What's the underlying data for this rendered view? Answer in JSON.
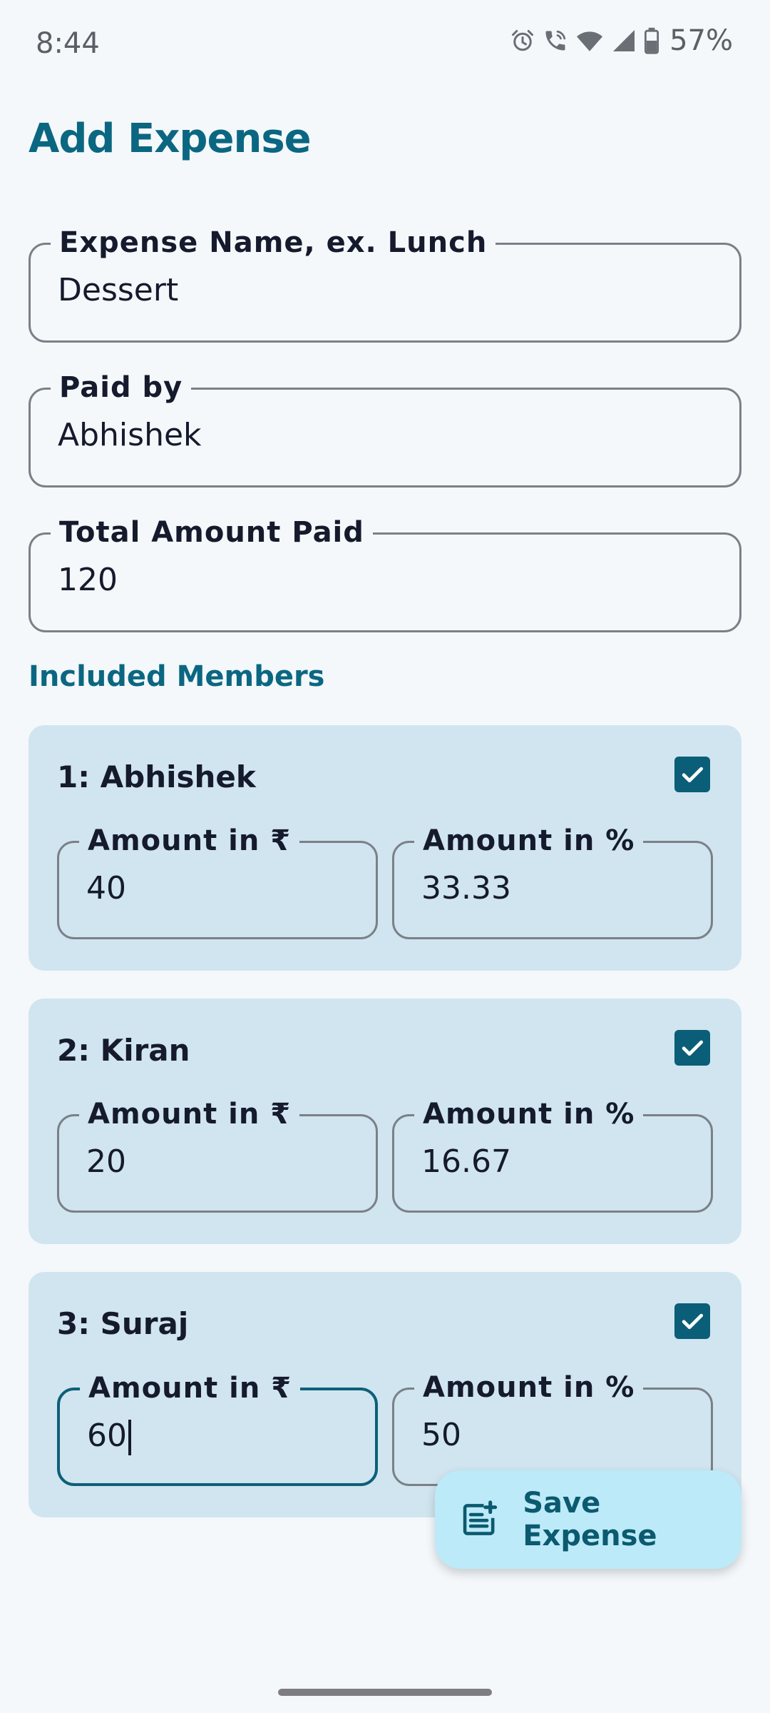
{
  "status_bar": {
    "time": "8:44",
    "battery": "57%",
    "icons": [
      "alarm-icon",
      "wifi-call-icon",
      "wifi-icon",
      "signal-icon",
      "battery-icon"
    ]
  },
  "page": {
    "title": "Add Expense"
  },
  "form": {
    "expense_name": {
      "label": "Expense Name, ex. Lunch",
      "value": "Dessert"
    },
    "paid_by": {
      "label": "Paid by",
      "value": "Abhishek"
    },
    "total_amount": {
      "label": "Total Amount Paid",
      "value": "120"
    }
  },
  "members_section": {
    "label": "Included Members",
    "members": [
      {
        "name": "1: Abhishek",
        "checked": true,
        "amount_label": "Amount in ₹",
        "amount": "40",
        "percent_label": "Amount in %",
        "percent": "33.33"
      },
      {
        "name": "2: Kiran",
        "checked": true,
        "amount_label": "Amount in ₹",
        "amount": "20",
        "percent_label": "Amount in %",
        "percent": "16.67"
      },
      {
        "name": "3: Suraj",
        "checked": true,
        "amount_label": "Amount in ₹",
        "amount": "60",
        "percent_label": "Amount in %",
        "percent": "50"
      }
    ]
  },
  "fab": {
    "label": "Save Expense",
    "icon": "note-add-icon"
  },
  "colors": {
    "accent": "#0b6781",
    "card_background": "#d0e5ef",
    "page_background": "#f4f8fb",
    "fab_background": "#bdeaf8",
    "checkbox": "#0b5e78"
  }
}
